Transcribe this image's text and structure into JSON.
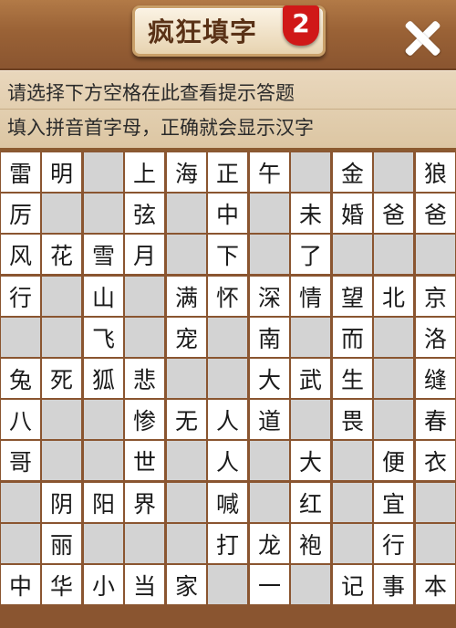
{
  "header": {
    "title": "疯狂填字",
    "level": "2"
  },
  "hint": {
    "line1": "请选择下方空格在此查看提示答题",
    "line2": "填入拼音首字母，正确就会显示汉字"
  },
  "grid": {
    "rows": [
      [
        "雷",
        "明",
        "#",
        "上",
        "海",
        "正",
        "午",
        "",
        "金",
        "",
        "狼"
      ],
      [
        "厉",
        "#",
        "#",
        "弦",
        "#",
        "中",
        "#",
        "未",
        "婚",
        "爸",
        "爸"
      ],
      [
        "风",
        "花",
        "雪",
        "月",
        "#",
        "下",
        "#",
        "了",
        "#",
        "#",
        "#"
      ],
      [
        "行",
        "#",
        "山",
        "#",
        "满",
        "怀",
        "深",
        "情",
        "望",
        "北",
        "京"
      ],
      [
        "",
        "",
        "飞",
        "",
        "宠",
        "",
        "南",
        "",
        "而",
        "",
        "洛"
      ],
      [
        "兔",
        "死",
        "狐",
        "悲",
        "",
        "",
        "大",
        "武",
        "生",
        "",
        "缝"
      ],
      [
        "八",
        "",
        "",
        "惨",
        "无",
        "人",
        "道",
        "",
        "畏",
        "",
        "春"
      ],
      [
        "哥",
        "",
        "",
        "世",
        "",
        "人",
        "",
        "大",
        "",
        "便",
        "衣"
      ],
      [
        "",
        "阴",
        "阳",
        "界",
        "",
        "喊",
        "",
        "红",
        "",
        "宜",
        ""
      ],
      [
        "",
        "丽",
        "",
        "",
        "",
        "打",
        "龙",
        "袍",
        "",
        "行",
        ""
      ],
      [
        "中",
        "华",
        "小",
        "当",
        "家",
        "",
        "一",
        "",
        "记",
        "事",
        "本"
      ]
    ]
  }
}
